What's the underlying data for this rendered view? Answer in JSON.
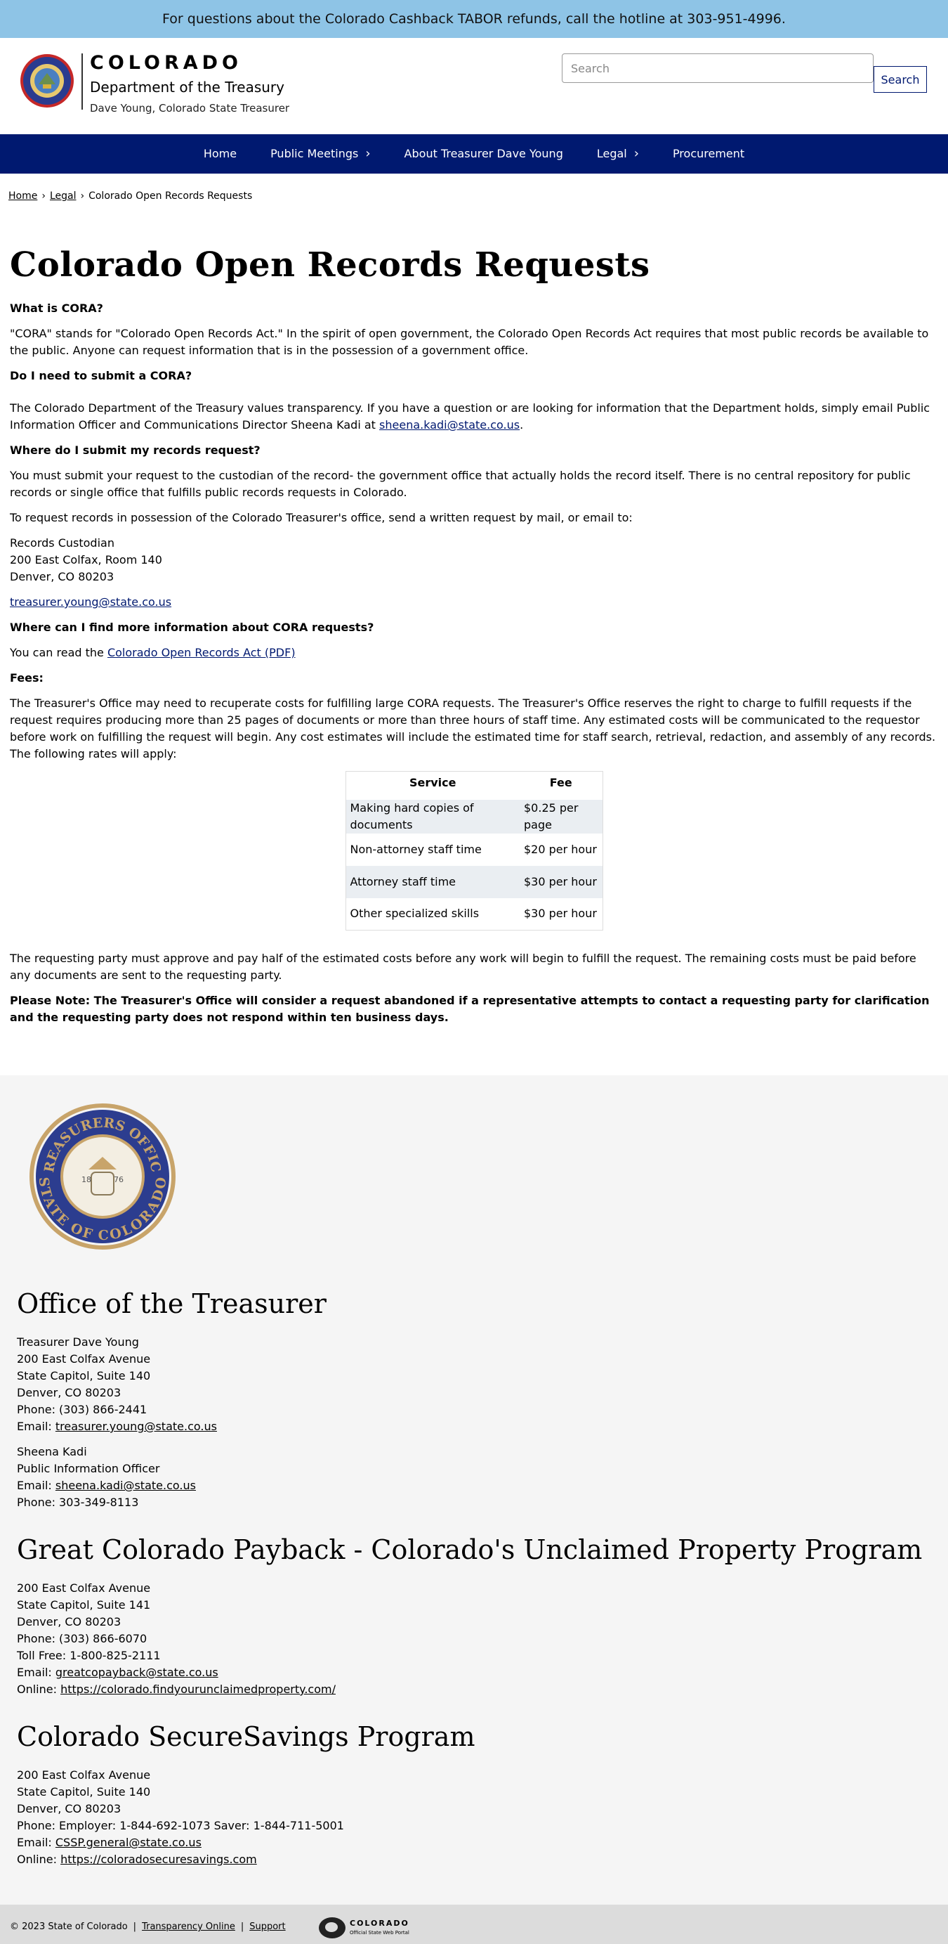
{
  "banner": {
    "text": "For questions about the Colorado Cashback TABOR refunds, call the hotline at 303-951-4996."
  },
  "header": {
    "brand_colorado": "COLORADO",
    "brand_dept": "Department of the Treasury",
    "brand_treasurer": "Dave Young, Colorado State Treasurer",
    "seal_text": "STATE OF COLORADO",
    "search_placeholder": "Search",
    "search_button": "Search"
  },
  "nav": {
    "items": [
      {
        "label": "Home",
        "has_chevron": false
      },
      {
        "label": "Public Meetings",
        "has_chevron": true,
        "chevron": "›"
      },
      {
        "label": "About Treasurer Dave Young",
        "has_chevron": false
      },
      {
        "label": "Legal",
        "has_chevron": true,
        "chevron": "›"
      },
      {
        "label": "Procurement",
        "has_chevron": false
      }
    ]
  },
  "breadcrumb": {
    "home": "Home",
    "legal": "Legal",
    "current": "Colorado Open Records Requests",
    "separator": "›"
  },
  "content": {
    "title": "Colorado Open Records Requests",
    "q1": "What is CORA?",
    "p1": "\"CORA\" stands for \"Colorado Open Records Act.\" In the spirit of open government, the Colorado Open Records Act requires that most public records be available to the public. Anyone can request information that is in the possession of a government office.",
    "q2": "Do I need to submit a CORA?",
    "p2_text": "The Colorado Department of the Treasury values transparency. If you have a question or are looking for information that the Department holds, simply email Public Information Officer and Communications Director Sheena Kadi at ",
    "p2_link": "sheena.kadi@state.co.us",
    "p2_end": ".",
    "q3": "Where do I submit my records request?",
    "p3": "You must submit your request to the custodian of the record- the government office that actually holds the record itself. There is no central repository for public records or single office that fulfills public records requests in Colorado.",
    "p4": "To request records in possession of the Colorado Treasurer's office, send a written request by mail, or email to:",
    "custodian": [
      "Records Custodian",
      "200 East Colfax, Room 140",
      "Denver, CO 80203"
    ],
    "custodian_email": "treasurer.young@state.co.us",
    "q4": "Where can I find more information about CORA requests?",
    "p5_text": "You can read the ",
    "p5_link": "Colorado Open Records Act (PDF)",
    "q5": "Fees:",
    "p6": "The Treasurer's Office may need to recuperate costs for fulfilling large CORA requests. The Treasurer's Office reserves the right to charge to fulfill requests if the request requires producing more than 25 pages of documents or more than three hours of staff time. Any estimated costs will be communicated to the requestor before work on fulfilling the request will begin. Any cost estimates will include the estimated time for staff search, retrieval, redaction, and assembly of any records. The following rates will apply:",
    "fee_table": {
      "headers": [
        "Service",
        "Fee"
      ],
      "rows": [
        [
          "Making hard copies of documents",
          "$0.25 per page"
        ],
        [
          "Non-attorney staff time",
          "$20 per hour"
        ],
        [
          "Attorney staff time",
          "$30 per hour"
        ],
        [
          "Other specialized skills",
          "$30 per hour"
        ]
      ]
    },
    "p7": "The requesting party must approve and pay half of the estimated costs before any work will begin to fulfill the request. The remaining costs must be paid before any documents are sent to the requesting party.",
    "p8": "Please Note: The Treasurer's Office will consider a request abandoned if a representative attempts to contact a requesting party for clarification and the requesting party does not respond within ten business days."
  },
  "footer": {
    "seal_text_top": "TREASURERS OFFICE",
    "seal_text_bottom": "STATE OF COLORADO",
    "seal_year_left": "18",
    "seal_year_right": "76",
    "office": {
      "title": "Office of the Treasurer",
      "lines": [
        "Treasurer Dave Young",
        "200 East Colfax Avenue",
        "State Capitol, Suite 140",
        "Denver, CO 80203",
        "Phone: (303) 866-2441"
      ],
      "email_label": "Email: ",
      "email": "treasurer.young@state.co.us",
      "pio_lines": [
        "Sheena Kadi",
        "Public Information Officer"
      ],
      "pio_email_label": "Email: ",
      "pio_email": "sheena.kadi@state.co.us",
      "pio_phone": "Phone: 303-349-8113"
    },
    "payback": {
      "title": "Great Colorado Payback - Colorado's Unclaimed Property Program",
      "lines": [
        "200 East Colfax Avenue",
        "State Capitol, Suite 141",
        "Denver, CO 80203",
        "Phone: (303) 866-6070",
        "Toll Free:  1-800-825-2111"
      ],
      "email_label": "Email: ",
      "email": "greatcopayback@state.co.us",
      "online_label": "Online: ",
      "online": "https://colorado.findyourunclaimedproperty.com/"
    },
    "securesavings": {
      "title": "Colorado SecureSavings Program",
      "lines": [
        "200 East Colfax Avenue",
        "State Capitol, Suite 140",
        "Denver, CO 80203",
        "Phone: Employer: 1-844-692-1073  Saver: 1-844-711-5001"
      ],
      "email_label": "Email: ",
      "email": "CSSP.general@state.co.us",
      "online_label": "Online: ",
      "online": "https://coloradosecuresavings.com"
    }
  },
  "bottom": {
    "copyright": "© 2023 State of Colorado",
    "pipe": "|",
    "transparency": "Transparency Online",
    "support": "Support",
    "logo_title": "COLORADO",
    "logo_sub": "Official State Web Portal"
  },
  "colors": {
    "banner": "#8ec4e6",
    "nav": "#001970",
    "link": "#001970",
    "footer_bg": "#f5f5f5",
    "bottom_bg": "#dcdcdc"
  }
}
